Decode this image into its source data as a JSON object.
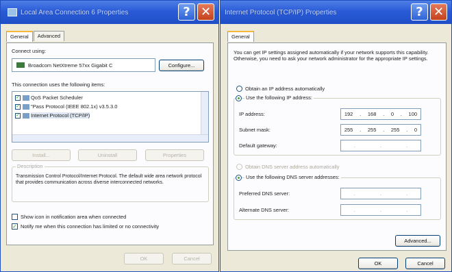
{
  "left_window": {
    "title": "Local Area Connection 6 Properties",
    "tabs": [
      "General",
      "Advanced"
    ],
    "connect_using_label": "Connect using:",
    "adapter_name": "Broadcom NetXtreme 57xx Gigabit C",
    "configure_button": "Configure...",
    "items_label": "This connection uses the following items:",
    "items": [
      "QoS Packet Scheduler",
      "\"Pass Protocol (IEEE 802.1x) v3.5.3.0",
      "Internet Protocol (TCP/IP)"
    ],
    "install_button": "Install...",
    "uninstall_button": "Uninstall",
    "properties_button": "Properties",
    "description_title": "Description",
    "description_text": "Transmission Control Protocol/Internet Protocol. The default wide area network protocol that provides communication across diverse interconnected networks.",
    "show_icon_label": "Show icon in notification area when connected",
    "notify_label": "Notify me when this connection has limited or no connectivity",
    "ok_button": "OK",
    "cancel_button": "Cancel"
  },
  "right_window": {
    "title": "Internet Protocol (TCP/IP) Properties",
    "tabs": [
      "General"
    ],
    "intro_text": "You can get IP settings assigned automatically if your network supports this capability. Otherwise, you need to ask your network administrator for the appropriate IP settings.",
    "obtain_ip_label": "Obtain an IP address automatically",
    "use_ip_label": "Use the following IP address:",
    "ip_address_label": "IP address:",
    "ip_address_value": [
      "192",
      "168",
      "0",
      "100"
    ],
    "subnet_label": "Subnet mask:",
    "subnet_value": [
      "255",
      "255",
      "255",
      "0"
    ],
    "gateway_label": "Default gateway:",
    "obtain_dns_label": "Obtain DNS server address automatically",
    "use_dns_label": "Use the following DNS server addresses:",
    "preferred_dns_label": "Preferred DNS server:",
    "alternate_dns_label": "Alternate DNS server:",
    "advanced_button": "Advanced...",
    "ok_button": "OK",
    "cancel_button": "Cancel"
  },
  "titlebar_buttons": {
    "help": "?",
    "close": "✕"
  },
  "colors": {
    "titlebar": "#2a5bd7",
    "dialog_bg": "#ece9d8",
    "panel_bg": "#fcfcfe",
    "selection_accent": "#f5b73a"
  }
}
